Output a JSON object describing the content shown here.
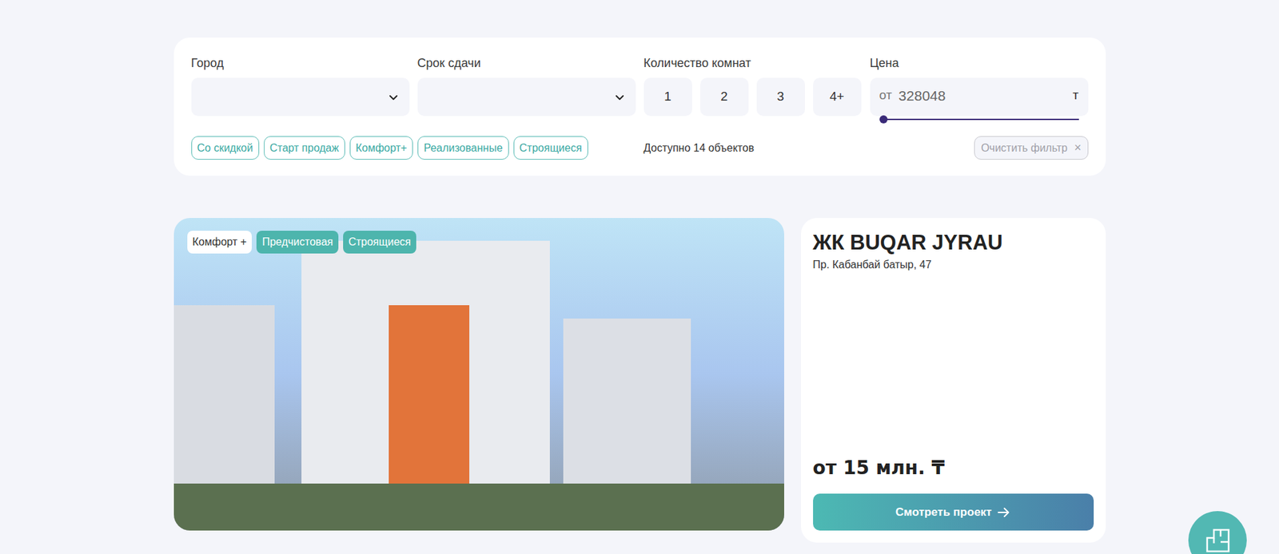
{
  "filters": {
    "city": {
      "label": "Город"
    },
    "deadline": {
      "label": "Срок сдачи"
    },
    "rooms": {
      "label": "Количество комнат",
      "options": [
        {
          "label": "1",
          "selected": false
        },
        {
          "label": "2",
          "selected": false
        },
        {
          "label": "3",
          "selected": false
        },
        {
          "label": "4+",
          "selected": false
        }
      ]
    },
    "price": {
      "label": "Цена",
      "prefix": "от",
      "value": "328048",
      "currency": "т",
      "level": 0
    }
  },
  "tags": [
    {
      "label": "Со скидкой",
      "selected": false
    },
    {
      "label": "Старт продаж",
      "selected": false
    },
    {
      "label": "Комфорт+",
      "selected": false
    },
    {
      "label": "Реализованные",
      "selected": false
    },
    {
      "label": "Строящиеся",
      "selected": false
    }
  ],
  "count": "Доступно 14 объектов",
  "clear": {
    "label": "Очистить фильтр",
    "icon": "×"
  },
  "project": {
    "badges": [
      {
        "label": "Комфорт +",
        "kind": "light"
      },
      {
        "label": "Предчистовая",
        "kind": "accent"
      },
      {
        "label": "Строящиеся",
        "kind": "accent"
      }
    ],
    "title": "ЖК BUQAR JYRAU",
    "address": "Пр. Кабанбай батыр, 47",
    "price": "от 15 млн. ₸",
    "button": "Смотреть проект"
  }
}
